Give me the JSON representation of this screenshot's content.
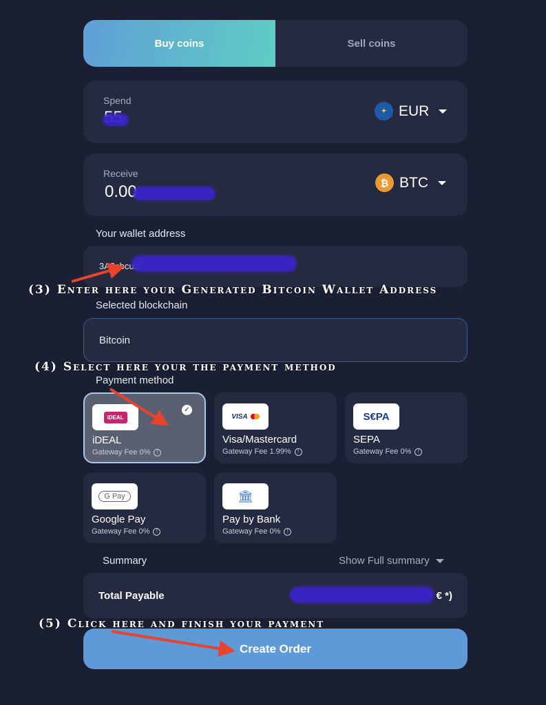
{
  "tabs": {
    "buy": "Buy coins",
    "sell": "Sell coins",
    "active": "buy"
  },
  "spend": {
    "label": "Spend",
    "value": "55",
    "currency": "EUR",
    "currency_icon": "eu-flag-icon"
  },
  "receive": {
    "label": "Receive",
    "value": "0.00",
    "currency": "BTC",
    "currency_icon": "bitcoin-icon"
  },
  "wallet": {
    "label": "Your wallet address",
    "value": "3A8cbcubi"
  },
  "blockchain": {
    "label": "Selected blockchain",
    "value": "Bitcoin"
  },
  "payment": {
    "label": "Payment method",
    "selected": "iDEAL",
    "methods": [
      {
        "name": "iDEAL",
        "fee": "Gateway Fee 0%",
        "logo_text": "iDEAL"
      },
      {
        "name": "Visa/Mastercard",
        "fee": "Gateway Fee 1.99%",
        "logo_text": "VISA"
      },
      {
        "name": "SEPA",
        "fee": "Gateway Fee 0%",
        "logo_text": "S€PA"
      },
      {
        "name": "Google Pay",
        "fee": "Gateway Fee 0%",
        "logo_text": "G Pay"
      },
      {
        "name": "Pay by Bank",
        "fee": "Gateway Fee 0%",
        "logo_text": "🏛"
      }
    ]
  },
  "summary": {
    "label": "Summary",
    "toggle": "Show Full summary",
    "total_label": "Total Payable",
    "total_value": "€ *)"
  },
  "cta": {
    "label": "Create Order"
  },
  "annotations": {
    "step3": "(3) Enter here your Generated Bitcoin Wallet Address",
    "step4": "(4) Select here your the payment method",
    "step5": "(5) Click here and finish your payment"
  },
  "colors": {
    "background": "#1b1f33",
    "card": "#262a40",
    "accent_button": "#5f9ad8",
    "annotation_arrow": "#e8432c",
    "redaction": "#3a24c9"
  }
}
